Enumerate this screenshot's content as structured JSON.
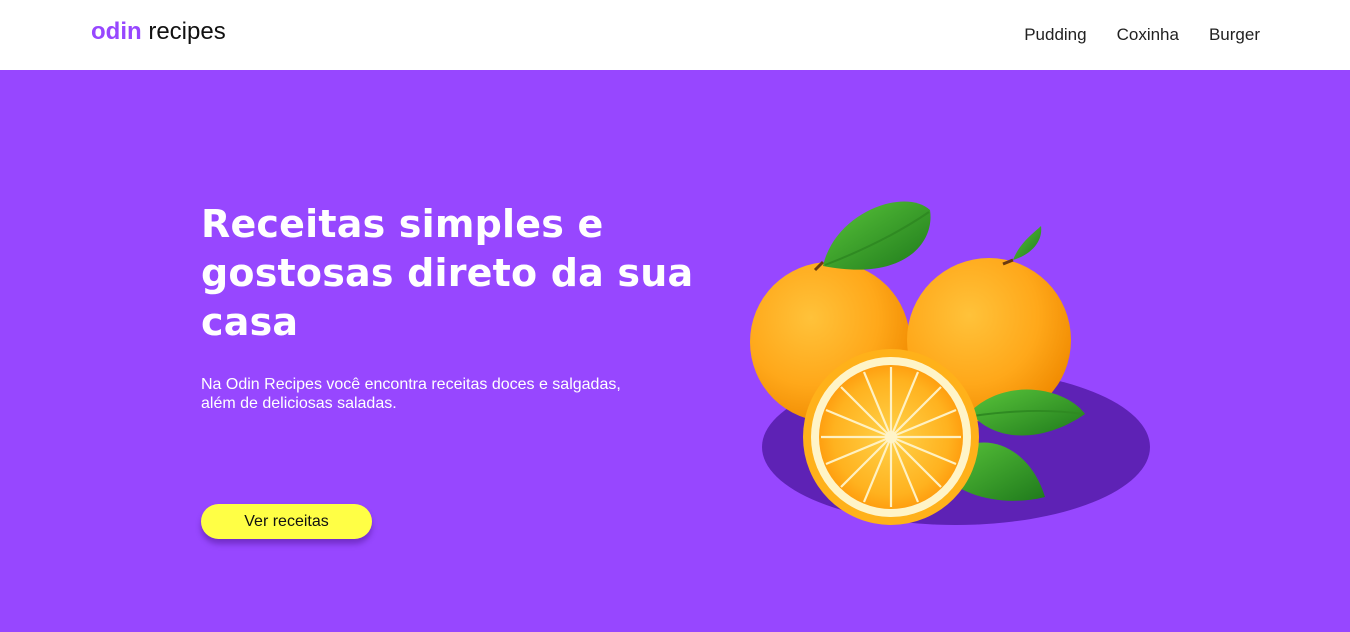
{
  "header": {
    "logo_accent": "odin",
    "logo_rest": " recipes",
    "nav": [
      "Pudding",
      "Coxinha",
      "Burger"
    ]
  },
  "hero": {
    "title": "Receitas simples e gostosas direto da sua casa",
    "description": "Na Odin Recipes você encontra receitas doces e salgadas, além de deliciosas saladas.",
    "cta_label": "Ver receitas",
    "image_icon": "oranges-illustration"
  },
  "colors": {
    "brand_purple": "#9747ff",
    "button_yellow": "#ffff45",
    "plate_purple": "#5e22b5"
  }
}
